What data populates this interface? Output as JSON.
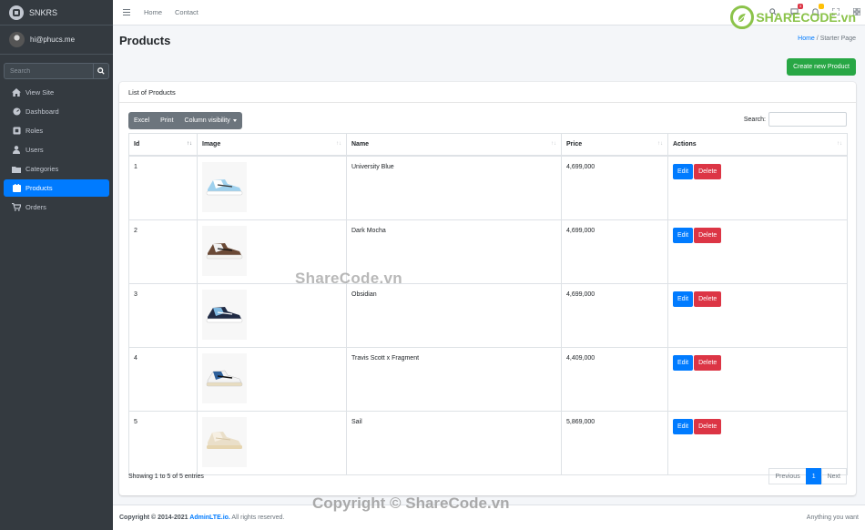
{
  "brand": {
    "name": "SNKRS"
  },
  "user": {
    "name": "hi@phucs.me"
  },
  "sidebar": {
    "search_placeholder": "Search",
    "items": [
      {
        "label": "View Site",
        "icon": "home-icon"
      },
      {
        "label": "Dashboard",
        "icon": "dashboard-icon"
      },
      {
        "label": "Roles",
        "icon": "roles-icon"
      },
      {
        "label": "Users",
        "icon": "user-icon"
      },
      {
        "label": "Categories",
        "icon": "folder-icon"
      },
      {
        "label": "Products",
        "icon": "box-icon",
        "active": true
      },
      {
        "label": "Orders",
        "icon": "cart-icon"
      }
    ]
  },
  "topbar": {
    "links": [
      "Home",
      "Contact"
    ],
    "badges": [
      "3",
      ""
    ]
  },
  "watermark": {
    "logo": "SHARECODE.vn",
    "center": "ShareCode.vn",
    "copyright": "Copyright © ShareCode.vn"
  },
  "page": {
    "title": "Products",
    "breadcrumb_home": "Home",
    "breadcrumb_current": "Starter Page",
    "create_button": "Create new Product"
  },
  "card": {
    "title": "List of Products"
  },
  "datatable": {
    "buttons": [
      "Excel",
      "Print",
      "Column visibility"
    ],
    "search_label": "Search:",
    "columns": [
      "Id",
      "Image",
      "Name",
      "Price",
      "Actions"
    ],
    "rows": [
      {
        "id": "1",
        "name": "University Blue",
        "price": "4,699,000"
      },
      {
        "id": "2",
        "name": "Dark Mocha",
        "price": "4,699,000"
      },
      {
        "id": "3",
        "name": "Obsidian",
        "price": "4,699,000"
      },
      {
        "id": "4",
        "name": "Travis Scott x Fragment",
        "price": "4,409,000"
      },
      {
        "id": "5",
        "name": "Sail",
        "price": "5,869,000"
      }
    ],
    "edit_label": "Edit",
    "delete_label": "Delete",
    "info": "Showing 1 to 5 of 5 entries",
    "pagination": {
      "previous": "Previous",
      "page": "1",
      "next": "Next"
    }
  },
  "footer": {
    "copyright_prefix": "Copyright © 2014-2021 ",
    "copyright_link": "AdminLTE.io.",
    "copyright_suffix": " All rights reserved.",
    "tagline": "Anything you want"
  },
  "colors": {
    "primary": "#007bff",
    "success": "#28a745",
    "danger": "#dc3545",
    "sidebar": "#343a40"
  }
}
